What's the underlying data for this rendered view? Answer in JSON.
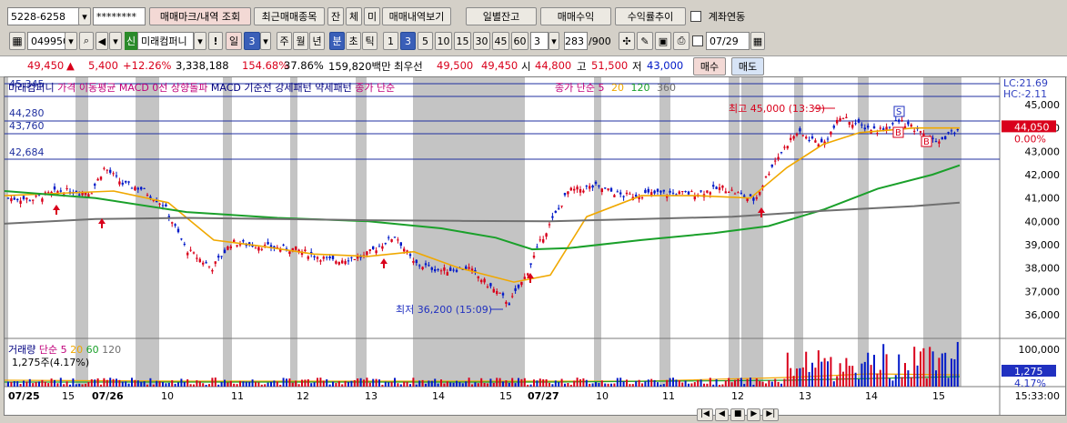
{
  "toolbar1": {
    "account_no": "5228-6258",
    "password": "********",
    "btn_order_history": "매매마크/내역 조회",
    "btn_recent_items": "최근매매종목",
    "btn_balance": "잔",
    "btn_execution": "체",
    "btn_unexecuted": "미",
    "btn_history_view": "매매내역보기",
    "btn_daily_balance": "일별잔고",
    "btn_trade_profit": "매매수익",
    "btn_return_trend": "수익률추이",
    "account_link_label": "계좌연동"
  },
  "toolbar2": {
    "stock_code": "049950",
    "market_badge": "신",
    "stock_name": "미래컴퍼니",
    "exclaim": "!",
    "period_selected": "일",
    "period_value": "3",
    "periods": [
      "주",
      "월",
      "년",
      "분",
      "초",
      "틱"
    ],
    "intervals": [
      "1",
      "3",
      "5",
      "10",
      "15",
      "30",
      "45",
      "60"
    ],
    "interval_selected": "3",
    "count_value": "3",
    "range": "283",
    "range_total": "/900",
    "date": "07/29"
  },
  "quote": {
    "price": "49,450",
    "arrow": "▲",
    "change": "5,400",
    "change_pct": "+12.26%",
    "volume": "3,338,188",
    "volume_ratio": "154.68%",
    "turnover_pct": "37.86%",
    "amount": "159,820백만",
    "priority_label": "최우선",
    "best_ask": "49,500",
    "best_bid": "49,450",
    "open_label": "시",
    "open": "44,800",
    "high_label": "고",
    "high": "51,500",
    "low_label": "저",
    "low": "43,000",
    "buy_label": "매수",
    "sell_label": "매도"
  },
  "chart_legend": {
    "stock": "미래컴퍼니",
    "ma": "가격 이동평균",
    "macd_up": "MACD 0선 상향돌파",
    "macd_signal": "MACD 기준선 강세패턴",
    "weak": "약세패턴",
    "close_simple": "종가 단순",
    "ma_label": "종가 단순 5",
    "ma20": "20",
    "ma120": "120",
    "ma360": "360",
    "lc": "LC:21.69",
    "hc": "HC:-2.11"
  },
  "annotations": {
    "high": "최고 45,000 (13:39)",
    "low": "최저 36,200 (15:09)"
  },
  "chart_data": {
    "type": "line",
    "price_axis": [
      "45,000",
      "44,000",
      "43,000",
      "42,000",
      "41,000",
      "40,000",
      "39,000",
      "38,000",
      "37,000",
      "36,000"
    ],
    "current_price_tag": "44,050",
    "current_pct_tag": "0.00%",
    "ref_lines": [
      "44,280",
      "43,760",
      "42,684"
    ],
    "ref_top_label": "45,345",
    "volume_axis": "100,000",
    "volume_tag": "1,275",
    "volume_pct_tag": "4.17%",
    "volume_legend": {
      "label": "거래량",
      "ma": "단순 5",
      "v20": "20",
      "v60": "60",
      "v120": "120",
      "value": "1,275주(4.17%)"
    },
    "x_labels": [
      "07/25",
      "15",
      "07/26",
      "10",
      "11",
      "12",
      "13",
      "14",
      "15",
      "07/27",
      "10",
      "11",
      "12",
      "13",
      "14",
      "15"
    ],
    "time": "15:33:00",
    "marks": [
      "S",
      "B",
      "B"
    ]
  },
  "colors": {
    "up": "#d9001b",
    "down": "#0019c8",
    "ma20": "#f0a800",
    "ma120": "#1aa02a",
    "ma360": "#707070",
    "shade": "#c4c4c4"
  }
}
